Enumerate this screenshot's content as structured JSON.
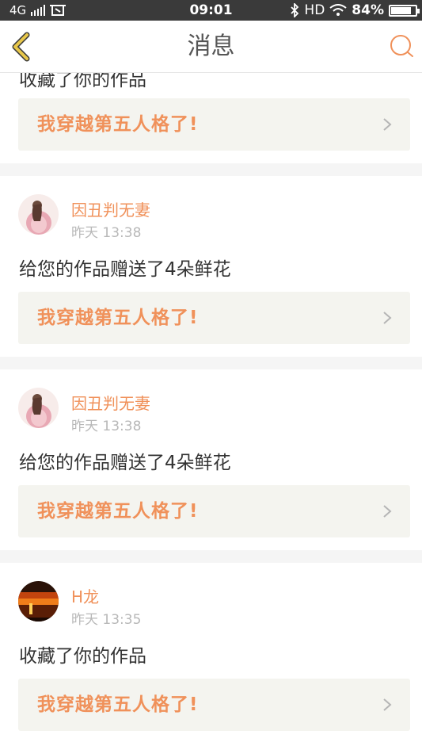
{
  "status_bar": {
    "network": "4G",
    "time": "09:01",
    "hd_label": "HD",
    "battery": "84%",
    "battery_level": 0.84
  },
  "header": {
    "title": "消息",
    "back_icon": "back-chevron-icon",
    "search_icon": "search-icon"
  },
  "colors": {
    "accent": "#f0915a",
    "back_icon": "#e8c74a",
    "card_box": "#f4f4ef"
  },
  "notifications": [
    {
      "message": "收藏了你的作品",
      "work_title": "我穿越第五人格了!"
    },
    {
      "user": "因丑判无妻",
      "time": "昨天 13:38",
      "message": "给您的作品赠送了4朵鲜花",
      "work_title": "我穿越第五人格了!"
    },
    {
      "user": "因丑判无妻",
      "time": "昨天 13:38",
      "message": "给您的作品赠送了4朵鲜花",
      "work_title": "我穿越第五人格了!"
    },
    {
      "user": "H龙",
      "time": "昨天 13:35",
      "message": "收藏了你的作品",
      "work_title": "我穿越第五人格了!"
    }
  ]
}
